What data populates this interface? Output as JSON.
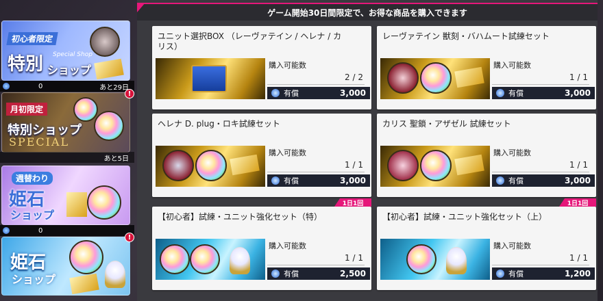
{
  "header": {
    "notice": "ゲーム開始30日間限定で、お得な商品を購入できます"
  },
  "sidebar": {
    "banners": [
      {
        "tag": "初心者限定",
        "title": "特別",
        "subtitle": "ショップ",
        "caption": "Special Shop",
        "count": "0",
        "remaining": "あと29日",
        "alert": ""
      },
      {
        "tag": "月初限定",
        "title": "特別ショップ",
        "caption": "SPECIAL",
        "count": "",
        "remaining": "あと5日",
        "alert": "!"
      },
      {
        "tag": "週替わり",
        "title": "姫石",
        "subtitle": "ショップ",
        "count": "0",
        "remaining": "",
        "alert": ""
      },
      {
        "tag": "",
        "title": "姫石",
        "subtitle": "ショップ",
        "count": "",
        "remaining": "",
        "alert": "!"
      }
    ]
  },
  "products": [
    {
      "name": "ユニット選択BOX （レーヴァテイン / ヘレナ / カリス）",
      "stock_label": "購入可能数",
      "stock": "2 / 2",
      "price_label": "有償",
      "price": "3,000",
      "badge": ""
    },
    {
      "name": "レーヴァテイン 獣刻・バハムート試練セット",
      "stock_label": "購入可能数",
      "stock": "1 / 1",
      "price_label": "有償",
      "price": "3,000",
      "badge": ""
    },
    {
      "name": "ヘレナ D. plug・ロキ試練セット",
      "stock_label": "購入可能数",
      "stock": "1 / 1",
      "price_label": "有償",
      "price": "3,000",
      "badge": ""
    },
    {
      "name": "カリス 聖鎖・アザゼル 試練セット",
      "stock_label": "購入可能数",
      "stock": "1 / 1",
      "price_label": "有償",
      "price": "3,000",
      "badge": ""
    },
    {
      "name": "【初心者】試練・ユニット強化セット（特）",
      "stock_label": "購入可能数",
      "stock": "1 / 1",
      "price_label": "有償",
      "price": "2,500",
      "badge": "1日1回"
    },
    {
      "name": "【初心者】試練・ユニット強化セット（上）",
      "stock_label": "購入可能数",
      "stock": "1 / 1",
      "price_label": "有償",
      "price": "1,200",
      "badge": "1日1回"
    }
  ],
  "colors": {
    "accent": "#e6177a",
    "panel": "#3a3a3f",
    "card": "#f5f5f5",
    "price_bar": "#1e2230"
  }
}
